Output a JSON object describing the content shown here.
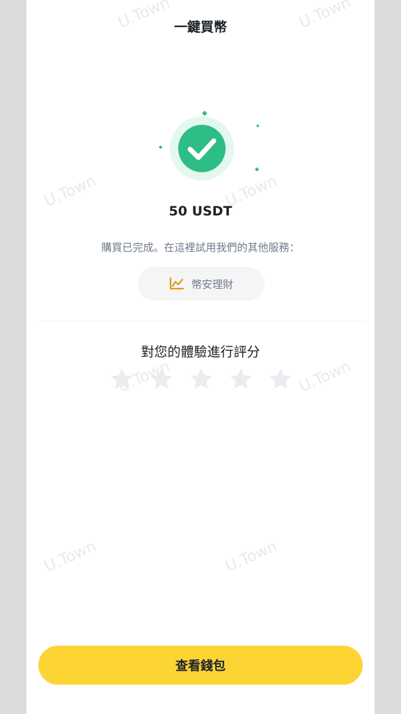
{
  "header": {
    "title": "一鍵買幣"
  },
  "result": {
    "amount": "50 USDT",
    "note": "購買已完成。在這裡試用我們的其他服務：",
    "service_button": "幣安理財"
  },
  "rating": {
    "title": "對您的體驗進行評分",
    "max_stars": 5,
    "selected": 0
  },
  "footer": {
    "primary_button": "查看錢包"
  },
  "watermark": "U.Town",
  "colors": {
    "accent_yellow": "#fcd535",
    "success_green": "#2ebd85",
    "text_primary": "#1e2329",
    "text_secondary": "#707a8a",
    "star_inactive": "#eaecef"
  }
}
